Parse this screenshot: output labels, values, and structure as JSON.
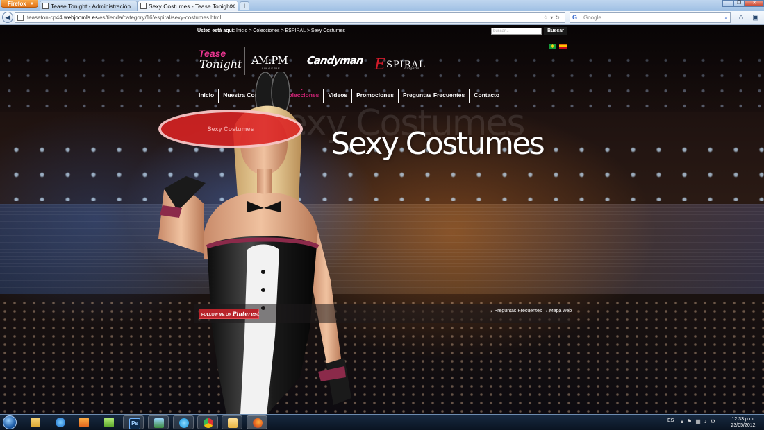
{
  "browser": {
    "menu_label": "Firefox",
    "tabs": [
      {
        "title": "Tease Tonight - Administración",
        "active": false
      },
      {
        "title": "Sexy Costumes - Tease Tonight",
        "active": true
      }
    ],
    "new_tab": "+",
    "url_prefix": "teaseton-cp44.",
    "url_domain": "webjoomla.es",
    "url_path": "/es/tienda/category/16/espiral/sexy-costumes.html",
    "search_placeholder": "Google"
  },
  "page": {
    "breadcrumb": {
      "label": "Usted está aquí:",
      "items": [
        "Inicio",
        "Colecciones",
        "ESPIRAL",
        "Sexy Costumes"
      ],
      "separator": ">"
    },
    "search": {
      "placeholder": "buscar...",
      "button": "Buscar"
    },
    "logos": {
      "tease_line1": "Tease",
      "tease_line2": "Tonight",
      "ampm": "AM:PM",
      "ampm_sub": "LINGERIE",
      "candyman": "Candyman",
      "espiral_initial": "E",
      "espiral_rest": "SPIRAL",
      "espiral_sub": "Lingerie"
    },
    "nav": [
      {
        "label": "Inicio",
        "active": false
      },
      {
        "label": "Nuestra Compañía",
        "active": false
      },
      {
        "label": "Colecciones",
        "active": true
      },
      {
        "label": "Videos",
        "active": false
      },
      {
        "label": "Promociones",
        "active": false
      },
      {
        "label": "Preguntas Frecuentes",
        "active": false
      },
      {
        "label": "Contacto",
        "active": false
      }
    ],
    "submenu_highlight": "Sexy Costumes",
    "hero_title": "Sexy Costumes",
    "hero_ghost": "Sexy Costumes",
    "pinterest": {
      "prefix": "FOLLOW ME ON",
      "brand": "Pinterest"
    },
    "footer_links": [
      "Preguntas Frecuentes",
      "Mapa web"
    ],
    "colors": {
      "accent": "#d4257a",
      "highlight": "#dc2323"
    }
  },
  "taskbar": {
    "apps": [
      {
        "name": "explorer",
        "running": false
      },
      {
        "name": "internet-explorer",
        "running": false
      },
      {
        "name": "media-player",
        "running": false
      },
      {
        "name": "notepad-plus",
        "running": false
      },
      {
        "name": "photoshop",
        "label": "Ps",
        "running": true
      },
      {
        "name": "network",
        "running": true
      },
      {
        "name": "skype",
        "running": true
      },
      {
        "name": "chrome",
        "running": true
      },
      {
        "name": "folder",
        "running": true
      },
      {
        "name": "firefox",
        "running": true
      }
    ],
    "language": "ES",
    "time": "12:33 p.m.",
    "date": "23/05/2012"
  }
}
